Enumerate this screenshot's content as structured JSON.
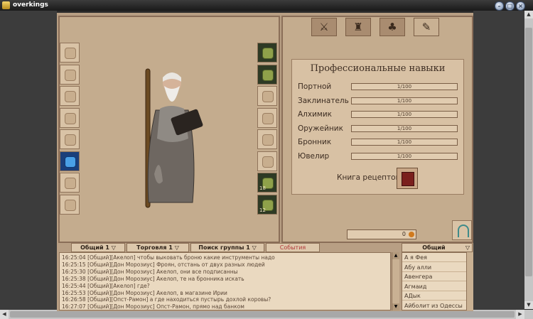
{
  "window": {
    "title": "overkings"
  },
  "equipment_left": [
    {
      "icon": "gloves-slot-icon"
    },
    {
      "icon": "helmet-slot-icon"
    },
    {
      "icon": "armor-slot-icon"
    },
    {
      "icon": "scroll-slot-icon"
    },
    {
      "icon": "scroll-slot-icon"
    },
    {
      "icon": "magic-wave-icon"
    },
    {
      "icon": "boots-slot-icon"
    },
    {
      "icon": "boots-slot-icon"
    }
  ],
  "equipment_right": [
    {
      "icon": "herb-icon"
    },
    {
      "icon": "potion-book-icon"
    },
    {
      "icon": "ring-slot-icon"
    },
    {
      "icon": "ring-slot-icon"
    },
    {
      "icon": "ring-slot-icon"
    },
    {
      "icon": "ring-slot-icon"
    },
    {
      "icon": "scroll-bundle-icon",
      "count": "18"
    },
    {
      "icon": "scroll-bundle-icon",
      "count": "12"
    }
  ],
  "tabs": [
    {
      "name": "combat-tab",
      "glyph": "⚔"
    },
    {
      "name": "party-tab",
      "glyph": "♜"
    },
    {
      "name": "inventory-tab",
      "glyph": "♣"
    },
    {
      "name": "skills-book-tab",
      "glyph": "✎"
    }
  ],
  "skills_panel": {
    "title": "Профессиональные навыки",
    "skills": [
      {
        "name": "Портной",
        "value": "1/100"
      },
      {
        "name": "Заклинатель",
        "value": "1/100"
      },
      {
        "name": "Алхимик",
        "value": "1/100"
      },
      {
        "name": "Оружейник",
        "value": "1/100"
      },
      {
        "name": "Бронник",
        "value": "1/100"
      },
      {
        "name": "Ювелир",
        "value": "1/100"
      }
    ],
    "recipes_label": "Книга рецептов"
  },
  "money": {
    "value": "0"
  },
  "chat": {
    "tabs": [
      "Общий 1",
      "Торговля 1",
      "Поиск группы 1",
      "События"
    ],
    "lines": [
      "16:25:04 [Общий][Акелоп] чтобы выковать броню какие инструменты надо",
      "16:25:15 [Общий][Дон Морозиус] Фроян, отстань от двух разных людей",
      "16:25:30 [Общий][Дон Морозиус] Акелоп, они все подписанны",
      "16:25:38 [Общий][Дон Морозиус] Акелоп, те на бронника искать",
      "16:25:44 [Общий][Акелоп] где?",
      "16:25:53 [Общий][Дон Морозиус] Акелоп, в магазине Ирии",
      "16:26:58 [Общий][Опст-Рамон] а где находиться пустырь дохлой коровы?",
      "16:27:07 [Общий][Дон Морозиус] Опст-Рамон, прямо над банком"
    ]
  },
  "players": {
    "channel": "Общий",
    "list": [
      "А я Фея",
      "Абу алли",
      "Авенгера",
      "Агмаид",
      "АДык",
      "Айболит из Одессы"
    ]
  }
}
